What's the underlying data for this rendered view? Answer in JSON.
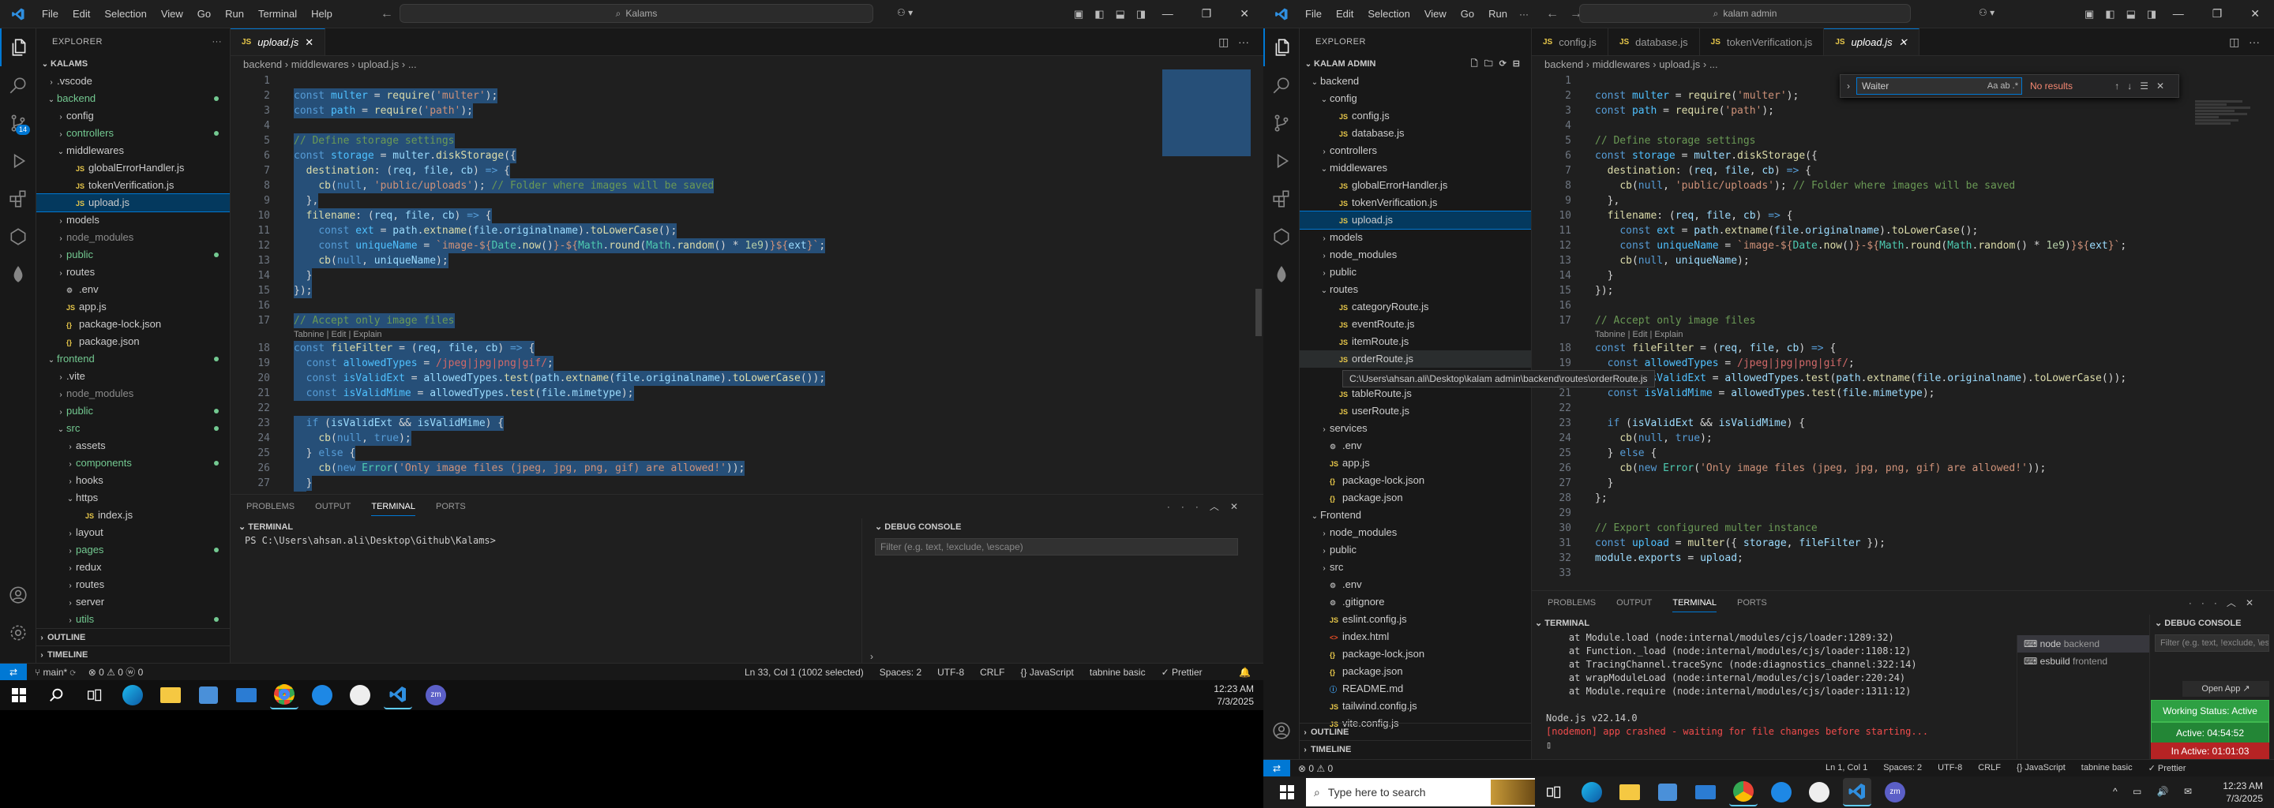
{
  "left_window": {
    "menu": [
      "File",
      "Edit",
      "Selection",
      "View",
      "Go",
      "Run",
      "Terminal",
      "Help"
    ],
    "search": "Kalams",
    "explorer_title": "EXPLORER",
    "root": "KALAMS",
    "tree": [
      {
        "label": "📁",
        "name": ".vscode",
        "depth": 1,
        "type": "folder",
        "open": false
      },
      {
        "name": "backend",
        "depth": 1,
        "type": "folder",
        "open": true,
        "mod": true
      },
      {
        "name": "config",
        "depth": 2,
        "type": "folder",
        "open": false
      },
      {
        "name": "controllers",
        "depth": 2,
        "type": "folder",
        "open": false,
        "mod": true
      },
      {
        "name": "middlewares",
        "depth": 2,
        "type": "folder",
        "open": true
      },
      {
        "name": "globalErrorHandler.js",
        "depth": 3,
        "type": "file"
      },
      {
        "name": "tokenVerification.js",
        "depth": 3,
        "type": "file"
      },
      {
        "name": "upload.js",
        "depth": 3,
        "type": "file",
        "sel": true
      },
      {
        "name": "models",
        "depth": 2,
        "type": "folder",
        "open": false
      },
      {
        "name": "node_modules",
        "depth": 2,
        "type": "folder",
        "open": false,
        "dim": true
      },
      {
        "name": "public",
        "depth": 2,
        "type": "folder",
        "open": false,
        "mod": true
      },
      {
        "name": "routes",
        "depth": 2,
        "type": "folder",
        "open": false
      },
      {
        "name": ".env",
        "depth": 2,
        "type": "file"
      },
      {
        "name": "app.js",
        "depth": 2,
        "type": "file"
      },
      {
        "name": "package-lock.json",
        "depth": 2,
        "type": "file"
      },
      {
        "name": "package.json",
        "depth": 2,
        "type": "file"
      },
      {
        "name": "frontend",
        "depth": 1,
        "type": "folder",
        "open": true,
        "mod": true
      },
      {
        "name": ".vite",
        "depth": 2,
        "type": "folder",
        "open": false
      },
      {
        "name": "node_modules",
        "depth": 2,
        "type": "folder",
        "open": false,
        "dim": true
      },
      {
        "name": "public",
        "depth": 2,
        "type": "folder",
        "open": false,
        "mod": true
      },
      {
        "name": "src",
        "depth": 2,
        "type": "folder",
        "open": true,
        "mod": true
      },
      {
        "name": "assets",
        "depth": 3,
        "type": "folder",
        "open": false
      },
      {
        "name": "components",
        "depth": 3,
        "type": "folder",
        "open": false,
        "mod": true
      },
      {
        "name": "hooks",
        "depth": 3,
        "type": "folder",
        "open": false
      },
      {
        "name": "https",
        "depth": 3,
        "type": "folder",
        "open": true
      },
      {
        "name": "index.js",
        "depth": 4,
        "type": "file"
      },
      {
        "name": "layout",
        "depth": 3,
        "type": "folder",
        "open": false
      },
      {
        "name": "pages",
        "depth": 3,
        "type": "folder",
        "open": false,
        "mod": true
      },
      {
        "name": "redux",
        "depth": 3,
        "type": "folder",
        "open": false
      },
      {
        "name": "routes",
        "depth": 3,
        "type": "folder",
        "open": false
      },
      {
        "name": "server",
        "depth": 3,
        "type": "folder",
        "open": false
      },
      {
        "name": "utils",
        "depth": 3,
        "type": "folder",
        "open": false,
        "mod": true
      }
    ],
    "outline": "OUTLINE",
    "timeline": "TIMELINE",
    "tab": "upload.js",
    "breadcrumb": "backend  ›  middlewares  ›  upload.js  ›  ...",
    "panel_tabs": [
      "PROBLEMS",
      "OUTPUT",
      "TERMINAL",
      "PORTS"
    ],
    "terminal_label": "TERMINAL",
    "prompt": "PS C:\\Users\\ahsan.ali\\Desktop\\Github\\Kalams>",
    "debug_label": "DEBUG CONSOLE",
    "debug_filter": "Filter (e.g. text, !exclude, \\escape)",
    "status_branch": "main*",
    "status_errors": "⊗ 0  ⚠ 0  ⓦ 0",
    "status_right": [
      "Ln 33, Col 1 (1002 selected)",
      "Spaces: 2",
      "UTF-8",
      "CRLF",
      "{} JavaScript",
      "tabnine basic",
      "✓ Prettier"
    ]
  },
  "right_window": {
    "menu": [
      "File",
      "Edit",
      "Selection",
      "View",
      "Go",
      "Run"
    ],
    "search": "kalam admin",
    "explorer_title": "EXPLORER",
    "root": "KALAM ADMIN",
    "tree": [
      {
        "name": "backend",
        "depth": 1,
        "type": "folder",
        "open": true
      },
      {
        "name": "config",
        "depth": 2,
        "type": "folder",
        "open": true
      },
      {
        "name": "config.js",
        "depth": 3,
        "type": "file"
      },
      {
        "name": "database.js",
        "depth": 3,
        "type": "file"
      },
      {
        "name": "controllers",
        "depth": 2,
        "type": "folder",
        "open": false
      },
      {
        "name": "middlewares",
        "depth": 2,
        "type": "folder",
        "open": true
      },
      {
        "name": "globalErrorHandler.js",
        "depth": 3,
        "type": "file"
      },
      {
        "name": "tokenVerification.js",
        "depth": 3,
        "type": "file"
      },
      {
        "name": "upload.js",
        "depth": 3,
        "type": "file",
        "sel": true
      },
      {
        "name": "models",
        "depth": 2,
        "type": "folder",
        "open": false
      },
      {
        "name": "node_modules",
        "depth": 2,
        "type": "folder",
        "open": false
      },
      {
        "name": "public",
        "depth": 2,
        "type": "folder",
        "open": false
      },
      {
        "name": "routes",
        "depth": 2,
        "type": "folder",
        "open": true
      },
      {
        "name": "categoryRoute.js",
        "depth": 3,
        "type": "file"
      },
      {
        "name": "eventRoute.js",
        "depth": 3,
        "type": "file"
      },
      {
        "name": "itemRoute.js",
        "depth": 3,
        "type": "file"
      },
      {
        "name": "orderRoute.js",
        "depth": 3,
        "type": "file",
        "hover": true
      },
      {
        "name": "",
        "depth": 3,
        "type": "file"
      },
      {
        "name": "tableRoute.js",
        "depth": 3,
        "type": "file"
      },
      {
        "name": "userRoute.js",
        "depth": 3,
        "type": "file"
      },
      {
        "name": "services",
        "depth": 2,
        "type": "folder",
        "open": false
      },
      {
        "name": ".env",
        "depth": 2,
        "type": "file"
      },
      {
        "name": "app.js",
        "depth": 2,
        "type": "file"
      },
      {
        "name": "package-lock.json",
        "depth": 2,
        "type": "file"
      },
      {
        "name": "package.json",
        "depth": 2,
        "type": "file"
      },
      {
        "name": "Frontend",
        "depth": 1,
        "type": "folder",
        "open": true
      },
      {
        "name": "node_modules",
        "depth": 2,
        "type": "folder",
        "open": false
      },
      {
        "name": "public",
        "depth": 2,
        "type": "folder",
        "open": false
      },
      {
        "name": "src",
        "depth": 2,
        "type": "folder",
        "open": false
      },
      {
        "name": ".env",
        "depth": 2,
        "type": "file"
      },
      {
        "name": ".gitignore",
        "depth": 2,
        "type": "file"
      },
      {
        "name": "eslint.config.js",
        "depth": 2,
        "type": "file"
      },
      {
        "name": "index.html",
        "depth": 2,
        "type": "file"
      },
      {
        "name": "package-lock.json",
        "depth": 2,
        "type": "file"
      },
      {
        "name": "package.json",
        "depth": 2,
        "type": "file"
      },
      {
        "name": "README.md",
        "depth": 2,
        "type": "file"
      },
      {
        "name": "tailwind.config.js",
        "depth": 2,
        "type": "file"
      },
      {
        "name": "vite.config.js",
        "depth": 2,
        "type": "file"
      }
    ],
    "tooltip": "C:\\Users\\ahsan.ali\\Desktop\\kalam admin\\backend\\routes\\orderRoute.js",
    "outline": "OUTLINE",
    "timeline": "TIMELINE",
    "tabs": [
      "config.js",
      "database.js",
      "tokenVerification.js",
      "upload.js"
    ],
    "breadcrumb": "backend  ›  middlewares  ›  upload.js  ›  ...",
    "find_value": "Waiter",
    "find_result": "No results",
    "panel_tabs": [
      "PROBLEMS",
      "OUTPUT",
      "TERMINAL",
      "PORTS"
    ],
    "terminal_label": "TERMINAL",
    "terminal_lines": [
      "    at Module.load (node:internal/modules/cjs/loader:1289:32)",
      "    at Function._load (node:internal/modules/cjs/loader:1108:12)",
      "    at TracingChannel.traceSync (node:diagnostics_channel:322:14)",
      "    at wrapModuleLoad (node:internal/modules/cjs/loader:220:24)",
      "    at Module.require (node:internal/modules/cjs/loader:1311:12)",
      "",
      "Node.js v22.14.0",
      "[nodemon] app crashed - waiting for file changes before starting..."
    ],
    "term_sessions": [
      {
        "name": "node",
        "sub": "backend"
      },
      {
        "name": "esbuild",
        "sub": "frontend"
      }
    ],
    "debug_label": "DEBUG CONSOLE",
    "debug_filter": "Filter (e.g. text, !exclude, \\escape)",
    "open_app": "Open App ↗",
    "working_status": "Working Status: Active",
    "active_time": "Active: 04:54:52",
    "inactive_time": "In Active: 01:01:03",
    "status_errors": "⊗ 0  ⚠ 0",
    "status_right": [
      "Ln 1, Col 1",
      "Spaces: 2",
      "UTF-8",
      "CRLF",
      "{} JavaScript",
      "tabnine basic",
      "✓ Prettier"
    ]
  },
  "code": [
    {
      "n": "1",
      "h": ""
    },
    {
      "n": "2",
      "h": "<span class='kw'>const</span> <span class='cn'>multer</span> = <span class='fn'>require</span>(<span class='st'>'multer'</span>);"
    },
    {
      "n": "3",
      "h": "<span class='kw'>const</span> <span class='cn'>path</span> = <span class='fn'>require</span>(<span class='st'>'path'</span>);"
    },
    {
      "n": "4",
      "h": ""
    },
    {
      "n": "5",
      "h": "<span class='cm'>// Define storage settings</span>"
    },
    {
      "n": "6",
      "h": "<span class='kw'>const</span> <span class='cn'>storage</span> = <span class='vr'>multer</span>.<span class='fn'>diskStorage</span>({"
    },
    {
      "n": "7",
      "h": "  <span class='fn'>destination</span>: (<span class='vr'>req</span>, <span class='vr'>file</span>, <span class='vr'>cb</span>) <span class='kw'>=></span> {"
    },
    {
      "n": "8",
      "h": "    <span class='fn'>cb</span>(<span class='kw'>null</span>, <span class='st'>'public/uploads'</span>); <span class='cm'>// Folder where images will be saved</span>"
    },
    {
      "n": "9",
      "h": "  },"
    },
    {
      "n": "10",
      "h": "  <span class='fn'>filename</span>: (<span class='vr'>req</span>, <span class='vr'>file</span>, <span class='vr'>cb</span>) <span class='kw'>=></span> {"
    },
    {
      "n": "11",
      "h": "    <span class='kw'>const</span> <span class='cn'>ext</span> = <span class='vr'>path</span>.<span class='fn'>extname</span>(<span class='vr'>file</span>.<span class='vr'>originalname</span>).<span class='fn'>toLowerCase</span>();"
    },
    {
      "n": "12",
      "h": "    <span class='kw'>const</span> <span class='cn'>uniqueName</span> = <span class='st'>`image-${</span><span class='ty'>Date</span>.<span class='fn'>now</span>()<span class='st'>}-${</span><span class='ty'>Math</span>.<span class='fn'>round</span>(<span class='ty'>Math</span>.<span class='fn'>random</span>() * <span class='nm'>1e9</span>)<span class='st'>}${</span><span class='vr'>ext</span><span class='st'>}`</span>;"
    },
    {
      "n": "13",
      "h": "    <span class='fn'>cb</span>(<span class='kw'>null</span>, <span class='vr'>uniqueName</span>);"
    },
    {
      "n": "14",
      "h": "  }"
    },
    {
      "n": "15",
      "h": "});"
    },
    {
      "n": "16",
      "h": ""
    },
    {
      "n": "17",
      "h": "<span class='cm'>// Accept only image files</span>"
    },
    {
      "n": "lens",
      "h": "Tabnine | Edit | Explain"
    },
    {
      "n": "18",
      "h": "<span class='kw'>const</span> <span class='fn'>fileFilter</span> = (<span class='vr'>req</span>, <span class='vr'>file</span>, <span class='vr'>cb</span>) <span class='kw'>=></span> {"
    },
    {
      "n": "19",
      "h": "  <span class='kw'>const</span> <span class='cn'>allowedTypes</span> = <span class='rx'>/jpeg|jpg|png|gif/</span>;"
    },
    {
      "n": "20",
      "h": "  <span class='kw'>const</span> <span class='cn'>isValidExt</span> = <span class='vr'>allowedTypes</span>.<span class='fn'>test</span>(<span class='vr'>path</span>.<span class='fn'>extname</span>(<span class='vr'>file</span>.<span class='vr'>originalname</span>).<span class='fn'>toLowerCase</span>());"
    },
    {
      "n": "21",
      "h": "  <span class='kw'>const</span> <span class='cn'>isValidMime</span> = <span class='vr'>allowedTypes</span>.<span class='fn'>test</span>(<span class='vr'>file</span>.<span class='vr'>mimetype</span>);"
    },
    {
      "n": "22",
      "h": ""
    },
    {
      "n": "23",
      "h": "  <span class='kw'>if</span> (<span class='vr'>isValidExt</span> &amp;&amp; <span class='vr'>isValidMime</span>) {"
    },
    {
      "n": "24",
      "h": "    <span class='fn'>cb</span>(<span class='kw'>null</span>, <span class='kw'>true</span>);"
    },
    {
      "n": "25",
      "h": "  } <span class='kw'>else</span> {"
    },
    {
      "n": "26",
      "h": "    <span class='fn'>cb</span>(<span class='kw'>new</span> <span class='ty'>Error</span>(<span class='st'>'Only image files (jpeg, jpg, png, gif) are allowed!'</span>));"
    },
    {
      "n": "27",
      "h": "  }"
    },
    {
      "n": "28",
      "h": "};"
    },
    {
      "n": "29",
      "h": ""
    },
    {
      "n": "30",
      "h": "<span class='cm'>// Export configured multer instance</span>"
    },
    {
      "n": "31",
      "h": "<span class='kw'>const</span> <span class='cn'>upload</span> = <span class='fn'>multer</span>({ <span class='vr'>storage</span>, <span class='vr'>fileFilter</span> });"
    },
    {
      "n": "32",
      "h": "<span class='vr'>module</span>.<span class='vr'>exports</span> = <span class='vr'>upload</span>;"
    },
    {
      "n": "33",
      "h": ""
    }
  ],
  "left_taskbar": {
    "time": "12:23 AM",
    "date": "7/3/2025"
  },
  "right_taskbar": {
    "search": "Type here to search",
    "time": "12:23 AM",
    "date": "7/3/2025"
  }
}
